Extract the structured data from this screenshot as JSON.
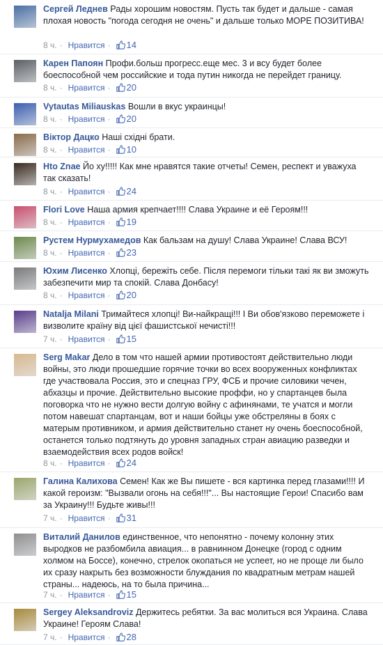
{
  "ui": {
    "like_label": "Нравится",
    "separator": "·"
  },
  "colors": {
    "author": "#365899",
    "link": "#4267b2",
    "meta": "#90949c",
    "divider": "#e9ebee"
  },
  "comments": [
    {
      "author": "Сергей Леднев",
      "text": "Рады хорошим новостям. Пусть так будет и дальше - самая плохая новость \"погода сегодня не очень\" и дальше только МОРЕ ПОЗИТИВА!",
      "time": "8 ч.",
      "likes": "14",
      "avatar_color": "#4a6fa5"
    },
    {
      "author": "Карен Папоян",
      "text": "Профи.больш прогресс.еще мес. 3 и всу будет более боеспособной чем российские и тода путин никогда не перейдет границу.",
      "time": "8 ч.",
      "likes": "20",
      "avatar_color": "#5b5f63"
    },
    {
      "author": "Vytautas Miliauskas",
      "text": "Вошли в вкус украинцы!",
      "time": "8 ч.",
      "likes": "20",
      "avatar_color": "#3a5fb0"
    },
    {
      "author": "Віктор Дацко",
      "text": "Наші східні брати.",
      "time": "8 ч.",
      "likes": "10",
      "avatar_color": "#8a6b4a"
    },
    {
      "author": "Hto Znae",
      "text": "Йо ху!!!!! Как мне нравятся такие отчеты! Семен, респект и уважуха так сказать!",
      "time": "8 ч.",
      "likes": "24",
      "avatar_color": "#3b2a1e"
    },
    {
      "author": "Flori Love",
      "text": "Наша армия крепчает!!!! Слава Украине и её Героям!!!",
      "time": "8 ч.",
      "likes": "19",
      "avatar_color": "#c94f6d"
    },
    {
      "author": "Рустем Нурмухамедов",
      "text": "Как бальзам на душу! Слава Украине! Слава ВСУ!",
      "time": "8 ч.",
      "likes": "23",
      "avatar_color": "#6e8a4c"
    },
    {
      "author": "Юхим Лисенко",
      "text": "Хлопці, бережіть себе. Після перемоги тільки такі як ви зможуть забезпечити мир та спокій. Слава Донбасу!",
      "time": "8 ч.",
      "likes": "20",
      "avatar_color": "#7a7a7a"
    },
    {
      "author": "Natalja Milani",
      "text": "Тримайтеся хлопці! Ви-найкращі!!! І Ви обов'язково переможете і визволите країну від цієї фашистської нечисті!!!",
      "time": "7 ч.",
      "likes": "15",
      "avatar_color": "#5a3d8c"
    },
    {
      "author": "Serg Makar",
      "text": "Дело в том что нашей армии противостоят действительно люди войны, это люди прошедшие горячие точки во всех вооруженных конфликтах где участвовала Россия, это и спецназ ГРУ, ФСБ и прочие силовики чечен, абхазцы и прочие. Действительно высокие проффи, но у спартанцев была поговорка что не нужно вести долгую войну с афинянами, те учатся и могли потом навешат спартанцам, вот и наши бойцы уже обстреляны в боях с матерым противником, и армия действительно станет ну очень боеспособной, останется только подтянуть до уровня западных стран авиацию разведки и взаемодействия всех родов войск!",
      "time": "8 ч.",
      "likes": "24",
      "avatar_color": "#d9b88f"
    },
    {
      "author": "Галина Калихова",
      "text": "Семен! Как же Вы пишете - вся картинка перед глазами!!!! И какой героизм: \"Вызвали огонь на себя!!!\"... Вы настоящие Герои! Спасибо вам за Украину!!! Будьте живы!!!",
      "time": "7 ч.",
      "likes": "31",
      "avatar_color": "#9aa66b"
    },
    {
      "author": "Виталий Данилов",
      "text": "единственное, что непонятно - почему колонну этих выродков не разбомбила авиация... в равнинном Донецке (город с одним холмом на Боссе), конечно, стрелок окопаться не успеет, но не проще ли было их сразу накрыть без возможности блуждания по квадратным метрам нашей страны... надеюсь, на то была причина...",
      "time": "7 ч.",
      "likes": "15",
      "avatar_color": "#8f8f8f"
    },
    {
      "author": "Sergey Aleksandroviz",
      "text": "Держитесь ребятки. За вас молиться вся Украина. Слава Украине! Героям Слава!",
      "time": "7 ч.",
      "likes": "28",
      "avatar_color": "#a88a3c"
    }
  ]
}
